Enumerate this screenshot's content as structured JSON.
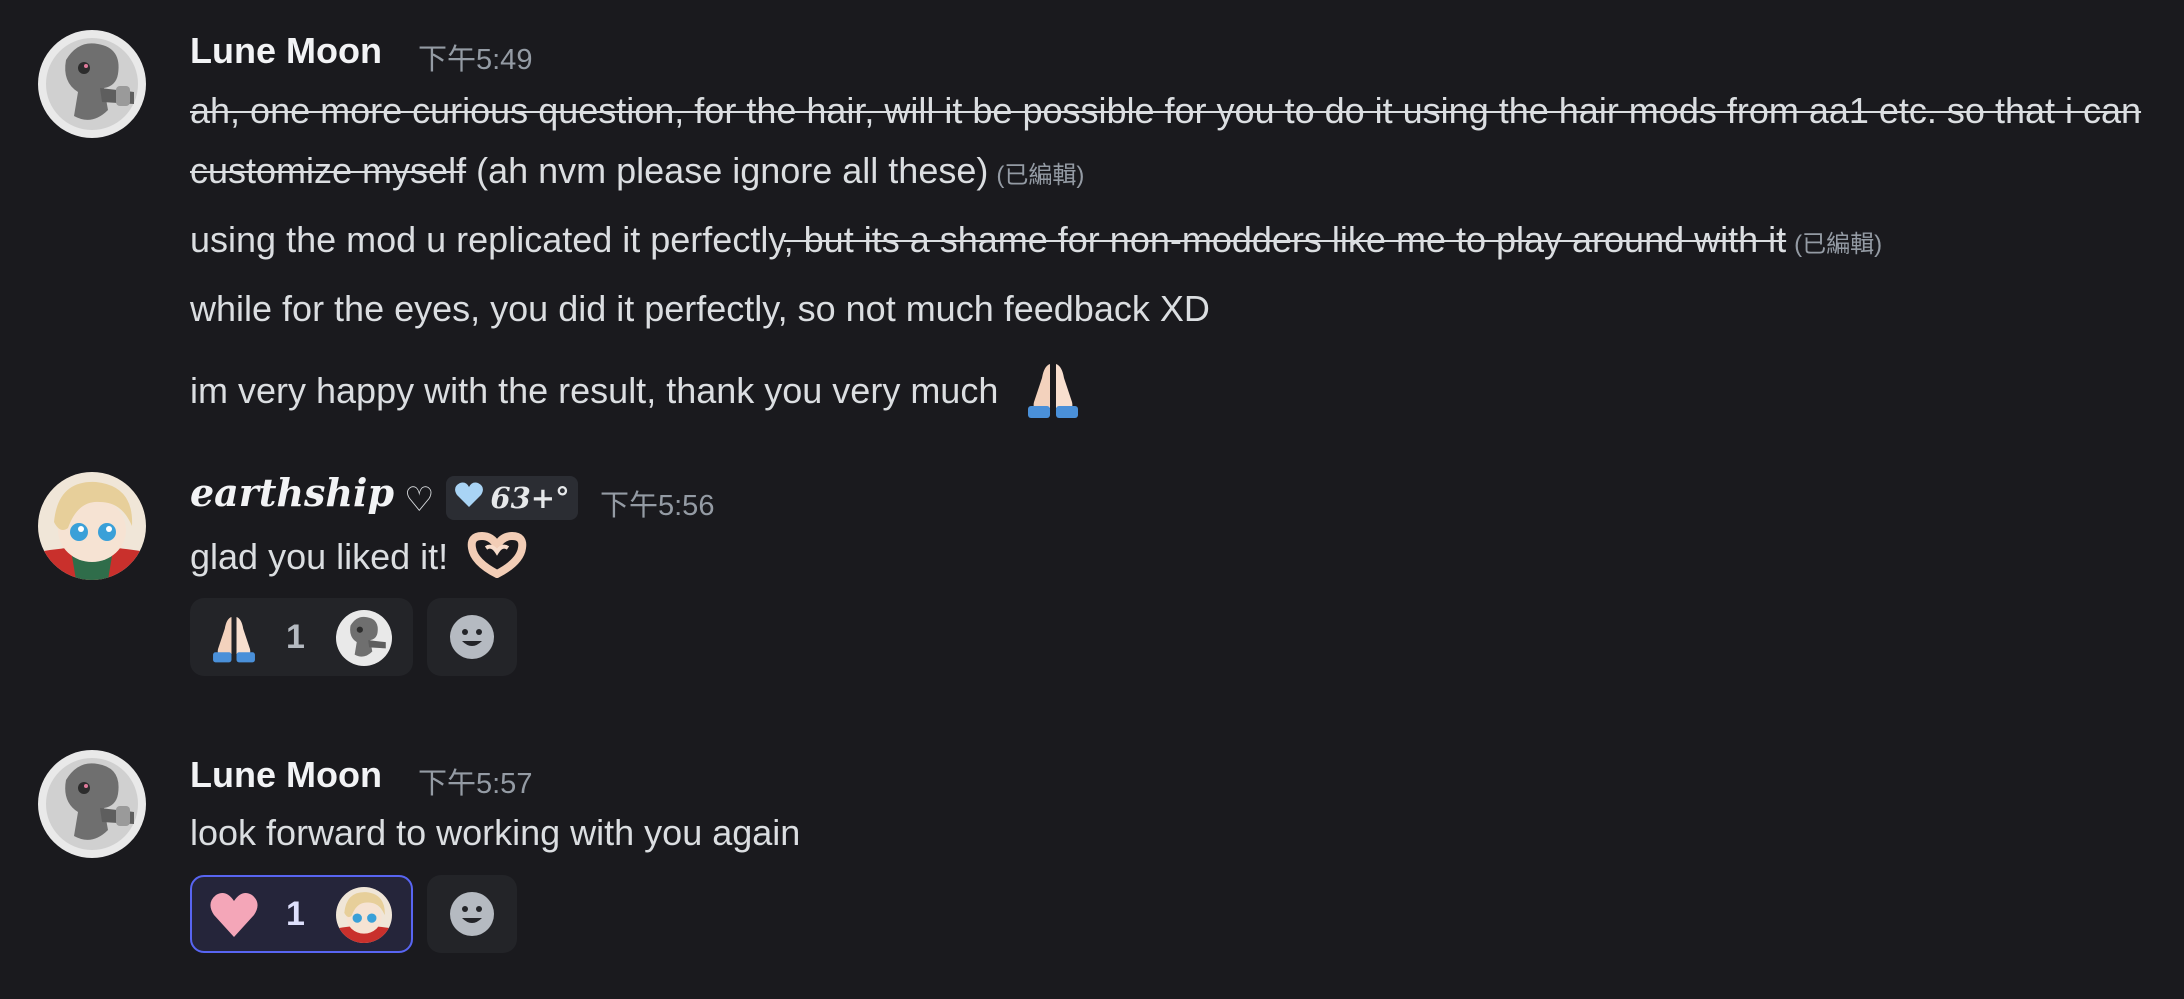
{
  "messages": [
    {
      "author": "Lune Moon",
      "time": "下午5:49",
      "lines": [
        {
          "strike": "ah, one more curious question, for the hair, will it be possible for you to do it using the hair mods from aa1 etc. so that i can"
        },
        {
          "strike": "customize myself",
          "normal": " (ah nvm please ignore all these)",
          "edited": "(已編輯)"
        },
        {
          "normal": "using the mod u replicated it perfectly",
          "strike": ", but its a shame for non-modders like me to play around with it",
          "edited": "(已編輯)"
        },
        {
          "normal": "while for the eyes, you did it perfectly, so not much feedback XD"
        },
        {
          "normal": "im very happy with the result, thank you very much",
          "emoji": "folded-hands"
        }
      ]
    },
    {
      "author": "earthship",
      "author_suffix": "♡",
      "badge": "63+°",
      "time": "下午5:56",
      "text": "glad you liked it!",
      "emoji": "heart-hands",
      "reaction": {
        "emoji": "folded-hands",
        "count": "1",
        "active": false
      }
    },
    {
      "author": "Lune Moon",
      "time": "下午5:57",
      "text": "look forward to working with you again",
      "reaction": {
        "emoji": "pink-heart",
        "count": "1",
        "active": true
      }
    }
  ],
  "colors": {
    "background": "#1a1a1e",
    "text": "#dbdee1",
    "muted": "#949ba4",
    "reaction_active_border": "#5865f2",
    "pink_heart": "#f4a6b8"
  }
}
